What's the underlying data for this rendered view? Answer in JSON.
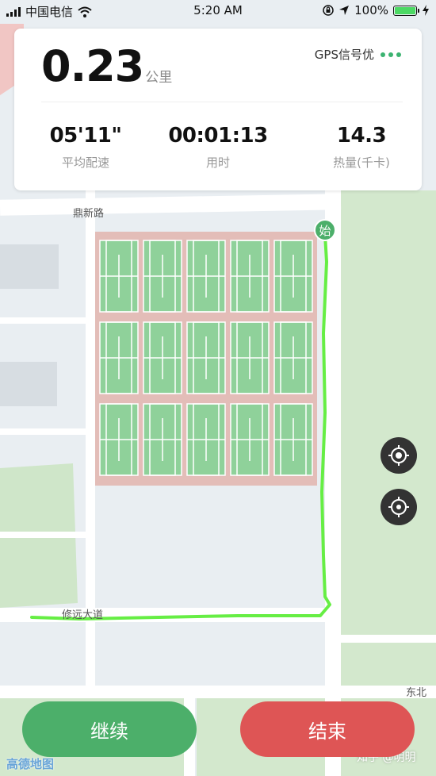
{
  "status_bar": {
    "carrier": "中国电信",
    "time": "5:20 AM",
    "battery_percent": "100%",
    "battery_level": 1.0
  },
  "stats": {
    "distance_value": "0.23",
    "distance_unit": "公里",
    "gps_status": "GPS信号优",
    "pace_value": "05'11\"",
    "pace_label": "平均配速",
    "duration_value": "00:01:13",
    "duration_label": "用时",
    "calories_value": "14.3",
    "calories_label": "热量(千卡)"
  },
  "map": {
    "road_labels": [
      "鼎新路",
      "修远大道",
      "东北"
    ],
    "start_marker": "始",
    "provider_logo": "高德地图",
    "watermark": "知乎 @明明"
  },
  "buttons": {
    "continue_label": "继续",
    "end_label": "结束"
  },
  "colors": {
    "route": "#66ee44",
    "continue": "#4caf6a",
    "end": "#de5555",
    "court": "#8fd19a",
    "court_surround": "#e3bdb8"
  },
  "icons": [
    "wifi-icon",
    "signal-icon",
    "location-arrow-icon",
    "orientation-lock-icon",
    "charging-icon",
    "locate-icon",
    "gps-target-icon"
  ]
}
